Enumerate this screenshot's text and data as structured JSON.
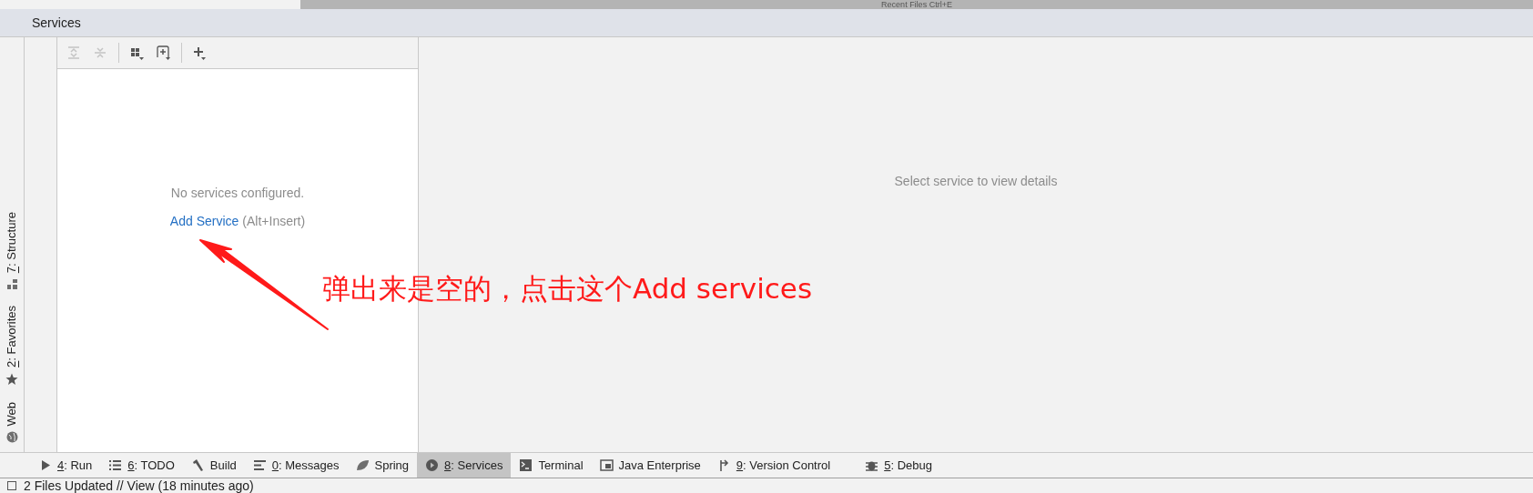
{
  "top_hint": "Recent Files Ctrl+E",
  "panel": {
    "title": "Services"
  },
  "side_tools": [
    {
      "kind": "web",
      "label": "Web"
    },
    {
      "kind": "favorites",
      "mnemonic": "2",
      "label": ": Favorites"
    },
    {
      "kind": "structure",
      "mnemonic": "7",
      "label": ": Structure"
    }
  ],
  "toolbar": [
    {
      "kind": "expand",
      "disabled": true
    },
    {
      "kind": "collapse",
      "disabled": true
    },
    {
      "kind": "group",
      "disabled": false
    },
    {
      "kind": "add-group",
      "disabled": false
    },
    {
      "kind": "add",
      "disabled": false
    }
  ],
  "empty": {
    "message": "No services configured.",
    "link": "Add Service",
    "shortcut": "(Alt+Insert)"
  },
  "detail": {
    "message": "Select service to view details"
  },
  "annotation": "弹出来是空的，点击这个Add services",
  "tool_tabs": [
    {
      "kind": "run",
      "mnemonic": "4",
      "label": ": Run",
      "selected": false
    },
    {
      "kind": "todo",
      "mnemonic": "6",
      "label": ": TODO",
      "selected": false
    },
    {
      "kind": "build",
      "label": "Build",
      "selected": false
    },
    {
      "kind": "messages",
      "mnemonic": "0",
      "label": ": Messages",
      "selected": false
    },
    {
      "kind": "spring",
      "label": "Spring",
      "selected": false
    },
    {
      "kind": "services",
      "mnemonic": "8",
      "label": ": Services",
      "selected": true
    },
    {
      "kind": "terminal",
      "label": "Terminal",
      "selected": false
    },
    {
      "kind": "javaee",
      "label": "Java Enterprise",
      "selected": false
    },
    {
      "kind": "vcs",
      "mnemonic": "9",
      "label": ": Version Control",
      "selected": false
    },
    {
      "kind": "debug",
      "mnemonic": "5",
      "label": ": Debug",
      "selected": false
    }
  ],
  "status": "2 Files Updated // View (18 minutes ago)"
}
